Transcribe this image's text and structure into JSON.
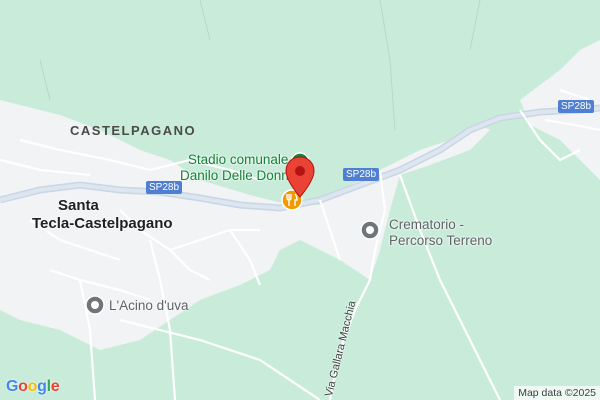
{
  "map": {
    "colors": {
      "land": "#c8ecd9",
      "urban": "#f1f3f4",
      "road_major": "#c9d6e6",
      "road_minor": "#ffffff",
      "pin": "#ea4335",
      "poi_green": "#188038",
      "poi_grey": "#70757a",
      "restaurant": "#f29900"
    },
    "labels": {
      "town_castelpagano": "CASTELPAGANO",
      "city_line1": "Santa",
      "city_line2": "Tecla-Castelpagano",
      "stadium_line1": "Stadio comunale",
      "stadium_line2": "Danilo Delle Donne",
      "crematorio_line1": "Crematorio -",
      "crematorio_line2": "Percorso Terreno",
      "acino": "L'Acino d'uva",
      "street_gallara": "Via Gallara Macchia"
    },
    "road_shields": {
      "sp28b_left": "SP28b",
      "sp28b_mid": "SP28b",
      "sp28b_right": "SP28b"
    },
    "icons": {
      "pin": "red-location-pin-icon",
      "restaurant": "restaurant-icon",
      "stadium": "stadium-poi-icon",
      "crematorio": "place-poi-icon",
      "acino": "place-poi-icon"
    },
    "attribution": "Map data ©2025",
    "logo": {
      "letters": [
        "G",
        "o",
        "o",
        "g",
        "l",
        "e"
      ],
      "colors": [
        "#4285f4",
        "#ea4335",
        "#fbbc05",
        "#4285f4",
        "#34a853",
        "#ea4335"
      ]
    }
  }
}
